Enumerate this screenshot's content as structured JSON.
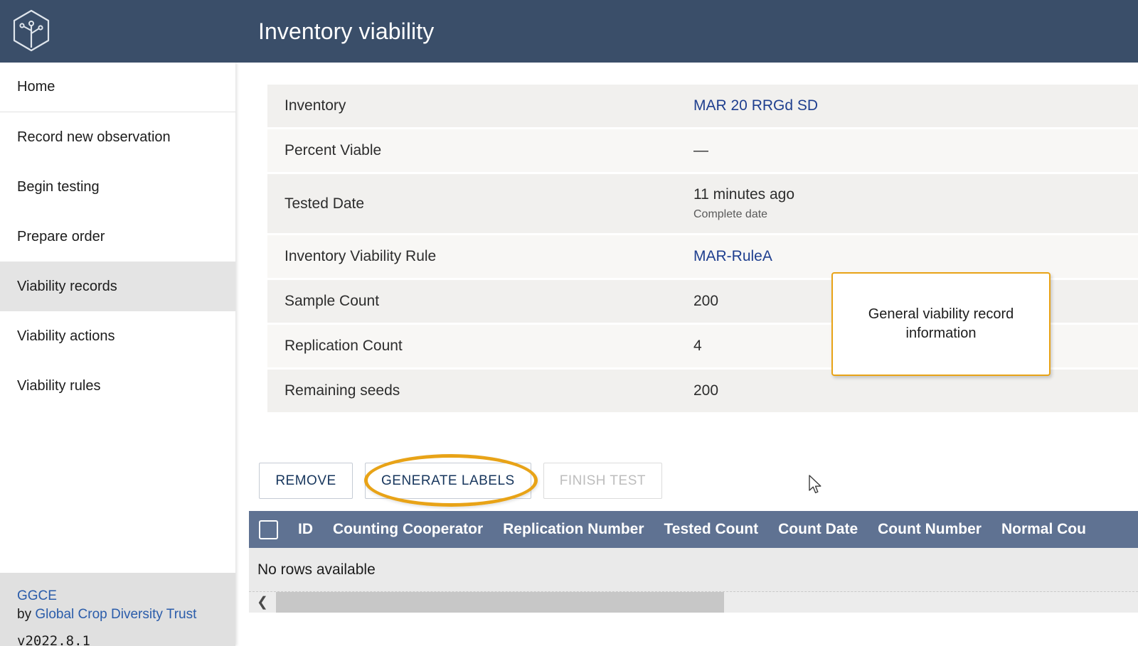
{
  "appbar": {
    "title": "Inventory viability",
    "logo_icon": "hexagon-tree-logo-icon",
    "background": "#3a4e69"
  },
  "sidebar": {
    "items": [
      {
        "label": "Home",
        "active": false
      },
      {
        "label": "Record new observation",
        "active": false
      },
      {
        "label": "Begin testing",
        "active": false
      },
      {
        "label": "Prepare order",
        "active": false
      },
      {
        "label": "Viability records",
        "active": true
      },
      {
        "label": "Viability actions",
        "active": false
      },
      {
        "label": "Viability rules",
        "active": false
      }
    ],
    "footer": {
      "brand": "GGCE",
      "by_prefix": "by ",
      "by_org": "Global Crop Diversity Trust",
      "version": "v2022.8.1"
    }
  },
  "details": {
    "rows": [
      {
        "label": "Inventory",
        "value": "MAR 20 RRGd SD",
        "sub": "",
        "link": true
      },
      {
        "label": "Percent Viable",
        "value": "—",
        "sub": "",
        "link": false
      },
      {
        "label": "Tested Date",
        "value": "11 minutes ago",
        "sub": "Complete date",
        "link": false
      },
      {
        "label": "Inventory Viability Rule",
        "value": "MAR-RuleA",
        "sub": "",
        "link": true
      },
      {
        "label": "Sample Count",
        "value": "200",
        "sub": "",
        "link": false
      },
      {
        "label": "Replication Count",
        "value": "4",
        "sub": "",
        "link": false
      },
      {
        "label": "Remaining seeds",
        "value": "200",
        "sub": "",
        "link": false
      }
    ]
  },
  "actions": {
    "remove_label": "REMOVE",
    "generate_labels_label": "GENERATE LABELS",
    "finish_test_label": "FINISH TEST"
  },
  "grid": {
    "columns": [
      "ID",
      "Counting Cooperator",
      "Replication Number",
      "Tested Count",
      "Count Date",
      "Count Number",
      "Normal Cou"
    ],
    "empty_message": "No rows available",
    "header_background": "#5f7292",
    "scroll_left_icon": "chevron-left-icon"
  },
  "annotations": {
    "callout_text": "General viability record information",
    "accent_color": "#e8a317",
    "highlighted_button": "GENERATE LABELS"
  }
}
